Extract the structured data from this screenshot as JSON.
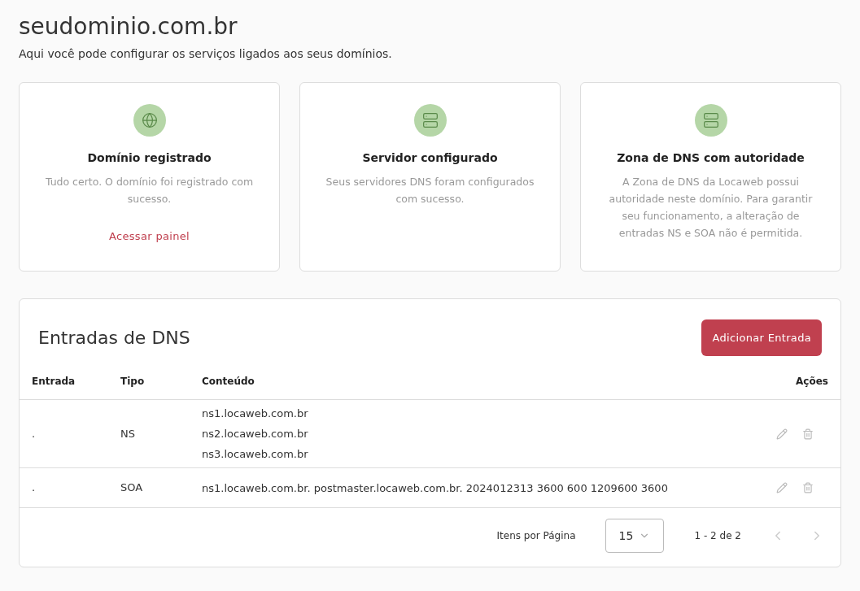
{
  "header": {
    "title": "seudominio.com.br",
    "subtitle": "Aqui você pode configurar os serviços ligados aos seus domínios."
  },
  "cards": [
    {
      "kind": "domain",
      "title": "Domínio registrado",
      "text": "Tudo certo. O domínio foi registrado com sucesso.",
      "link": "Acessar painel"
    },
    {
      "kind": "server",
      "title": "Servidor configurado",
      "text": "Seus servidores DNS foram configurados com sucesso."
    },
    {
      "kind": "zone",
      "title": "Zona de DNS com autoridade",
      "text": "A Zona de DNS da Locaweb possui autoridade neste domínio. Para garantir seu funcionamento, a alteração de entradas NS e SOA não é permitida."
    }
  ],
  "dns": {
    "title": "Entradas de DNS",
    "add_button": "Adicionar Entrada",
    "columns": [
      "Entrada",
      "Tipo",
      "Conteúdo",
      "Ações"
    ],
    "rows": [
      {
        "entry": ".",
        "type": "NS",
        "content": [
          "ns1.locaweb.com.br",
          "ns2.locaweb.com.br",
          "ns3.locaweb.com.br"
        ]
      },
      {
        "entry": ".",
        "type": "SOA",
        "content": [
          "ns1.locaweb.com.br. postmaster.locaweb.com.br. 2024012313 3600 600 1209600 3600"
        ]
      }
    ],
    "pagination": {
      "label": "Itens por Página",
      "per_page": "15",
      "range": "1 - 2 de 2",
      "prev_disabled": true,
      "next_disabled": true
    }
  }
}
